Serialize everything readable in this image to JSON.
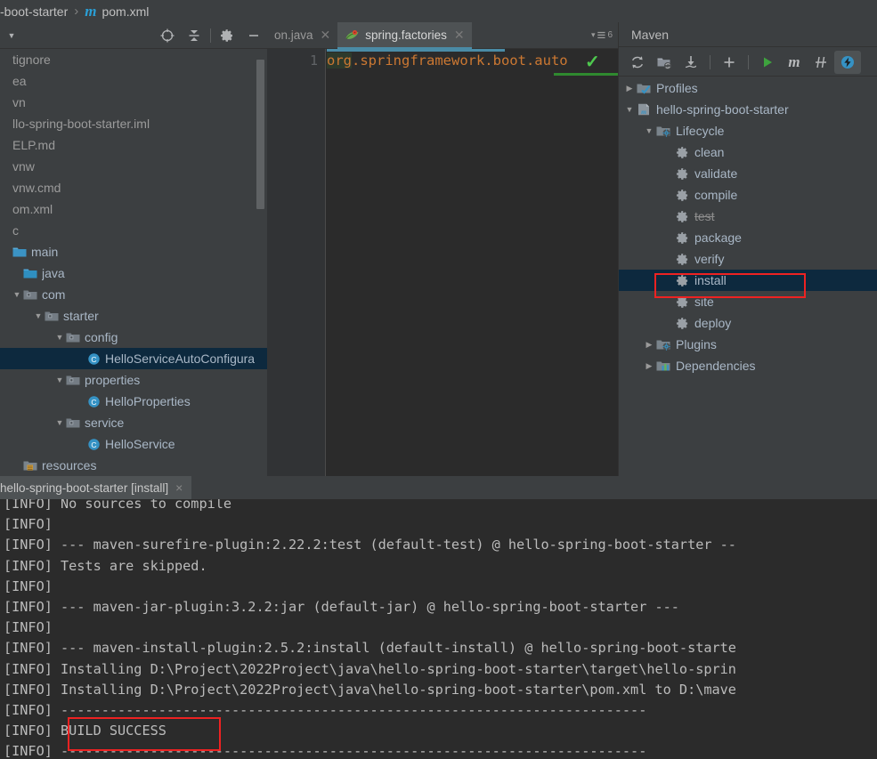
{
  "breadcrumb": {
    "project": "-boot-starter",
    "separator": "›",
    "file": "pom.xml",
    "file_icon": "maven-m-icon"
  },
  "project_panel": {
    "toolbar": [
      {
        "name": "select-opened-file-icon",
        "glyph": "▼"
      },
      {
        "name": "locate-target-icon",
        "glyph": "⊕"
      },
      {
        "name": "collapse-all-icon",
        "glyph": "⤓"
      },
      {
        "name": "settings-gear-icon",
        "glyph": "⚙"
      },
      {
        "name": "hide-panel-icon",
        "glyph": "—"
      }
    ],
    "tree": [
      {
        "label": "tignore",
        "indent": 0,
        "arrow": "",
        "icon": "none",
        "selected": false,
        "dim": true
      },
      {
        "label": "ea",
        "indent": 0,
        "arrow": "",
        "icon": "none",
        "selected": false,
        "dim": true
      },
      {
        "label": "vn",
        "indent": 0,
        "arrow": "",
        "icon": "none",
        "selected": false,
        "dim": true
      },
      {
        "label": "llo-spring-boot-starter.iml",
        "indent": 0,
        "arrow": "",
        "icon": "none",
        "selected": false,
        "dim": true
      },
      {
        "label": "ELP.md",
        "indent": 0,
        "arrow": "",
        "icon": "none",
        "selected": false,
        "dim": true
      },
      {
        "label": "vnw",
        "indent": 0,
        "arrow": "",
        "icon": "none",
        "selected": false,
        "dim": true
      },
      {
        "label": "vnw.cmd",
        "indent": 0,
        "arrow": "",
        "icon": "none",
        "selected": false,
        "dim": true
      },
      {
        "label": "om.xml",
        "indent": 0,
        "arrow": "",
        "icon": "none",
        "selected": false,
        "dim": true
      },
      {
        "label": "c",
        "indent": 0,
        "arrow": "",
        "icon": "none",
        "selected": false,
        "dim": true
      },
      {
        "label": "main",
        "indent": 0,
        "arrow": "",
        "icon": "folder",
        "selected": false,
        "dim": false
      },
      {
        "label": "java",
        "indent": 1,
        "arrow": "",
        "icon": "source-folder",
        "selected": false,
        "dim": false
      },
      {
        "label": "com",
        "indent": 1,
        "arrow": "▼",
        "icon": "package",
        "selected": false,
        "dim": false
      },
      {
        "label": "starter",
        "indent": 2,
        "arrow": "▼",
        "icon": "package",
        "selected": false,
        "dim": false
      },
      {
        "label": "config",
        "indent": 3,
        "arrow": "▼",
        "icon": "package",
        "selected": false,
        "dim": false
      },
      {
        "label": "HelloServiceAutoConfigura",
        "indent": 4,
        "arrow": "",
        "icon": "class",
        "selected": true,
        "dim": false
      },
      {
        "label": "properties",
        "indent": 3,
        "arrow": "▼",
        "icon": "package",
        "selected": false,
        "dim": false
      },
      {
        "label": "HelloProperties",
        "indent": 4,
        "arrow": "",
        "icon": "class",
        "selected": false,
        "dim": false
      },
      {
        "label": "service",
        "indent": 3,
        "arrow": "▼",
        "icon": "package",
        "selected": false,
        "dim": false
      },
      {
        "label": "HelloService",
        "indent": 4,
        "arrow": "",
        "icon": "class",
        "selected": false,
        "dim": false
      },
      {
        "label": "resources",
        "indent": 1,
        "arrow": "",
        "icon": "resource-folder",
        "selected": false,
        "dim": false
      }
    ]
  },
  "editor": {
    "tabs": [
      {
        "label": "on.java",
        "icon": "none",
        "active": false
      },
      {
        "label": "spring.factories",
        "icon": "spring-leaf-icon",
        "active": true
      }
    ],
    "tab_extra": {
      "chevron": "▾",
      "lines_icon": "≡",
      "count": "6"
    },
    "line_number": "1",
    "code": "org.springframework.boot.auto",
    "code_highlight": "org",
    "inspection_ok_glyph": "✓"
  },
  "maven": {
    "title": "Maven",
    "toolbar": [
      {
        "name": "reload-all-maven-projects-icon",
        "glyph": "↻"
      },
      {
        "name": "add-maven-project-icon",
        "glyph": "📁"
      },
      {
        "name": "download-sources-icon",
        "glyph": "⤓"
      },
      {
        "name": "separator",
        "glyph": ""
      },
      {
        "name": "add-icon",
        "glyph": "+"
      },
      {
        "name": "separator",
        "glyph": ""
      },
      {
        "name": "run-maven-build-icon",
        "glyph": "▶"
      },
      {
        "name": "execute-maven-goal-icon",
        "glyph": "m"
      },
      {
        "name": "toggle-skip-tests-icon",
        "glyph": "⫽"
      },
      {
        "name": "toggle-offline-mode-icon",
        "glyph": "⚡"
      }
    ],
    "tree": [
      {
        "label": "Profiles",
        "indent": 0,
        "arrow": "▶",
        "icon": "profiles",
        "selected": false,
        "struck": false
      },
      {
        "label": "hello-spring-boot-starter",
        "indent": 0,
        "arrow": "▼",
        "icon": "maven-project",
        "selected": false,
        "struck": false
      },
      {
        "label": "Lifecycle",
        "indent": 1,
        "arrow": "▼",
        "icon": "lifecycle",
        "selected": false,
        "struck": false
      },
      {
        "label": "clean",
        "indent": 2,
        "arrow": "",
        "icon": "goal",
        "selected": false,
        "struck": false
      },
      {
        "label": "validate",
        "indent": 2,
        "arrow": "",
        "icon": "goal",
        "selected": false,
        "struck": false
      },
      {
        "label": "compile",
        "indent": 2,
        "arrow": "",
        "icon": "goal",
        "selected": false,
        "struck": false
      },
      {
        "label": "test",
        "indent": 2,
        "arrow": "",
        "icon": "goal",
        "selected": false,
        "struck": true
      },
      {
        "label": "package",
        "indent": 2,
        "arrow": "",
        "icon": "goal",
        "selected": false,
        "struck": false
      },
      {
        "label": "verify",
        "indent": 2,
        "arrow": "",
        "icon": "goal",
        "selected": false,
        "struck": false
      },
      {
        "label": "install",
        "indent": 2,
        "arrow": "",
        "icon": "goal",
        "selected": true,
        "struck": false
      },
      {
        "label": "site",
        "indent": 2,
        "arrow": "",
        "icon": "goal",
        "selected": false,
        "struck": false
      },
      {
        "label": "deploy",
        "indent": 2,
        "arrow": "",
        "icon": "goal",
        "selected": false,
        "struck": false
      },
      {
        "label": "Plugins",
        "indent": 1,
        "arrow": "▶",
        "icon": "plugins",
        "selected": false,
        "struck": false
      },
      {
        "label": "Dependencies",
        "indent": 1,
        "arrow": "▶",
        "icon": "dependencies",
        "selected": false,
        "struck": false
      }
    ]
  },
  "console": {
    "tab_label": "hello-spring-boot-starter [install]",
    "tab_close": "×",
    "lines": [
      "[INFO] No sources to compile",
      "[INFO] ",
      "[INFO] --- maven-surefire-plugin:2.22.2:test (default-test) @ hello-spring-boot-starter --",
      "[INFO] Tests are skipped.",
      "[INFO] ",
      "[INFO] --- maven-jar-plugin:3.2.2:jar (default-jar) @ hello-spring-boot-starter ---",
      "[INFO] ",
      "[INFO] --- maven-install-plugin:2.5.2:install (default-install) @ hello-spring-boot-starte",
      "[INFO] Installing D:\\Project\\2022Project\\java\\hello-spring-boot-starter\\target\\hello-sprin",
      "[INFO] Installing D:\\Project\\2022Project\\java\\hello-spring-boot-starter\\pom.xml to D:\\mave",
      "[INFO] ------------------------------------------------------------------------",
      "[INFO] BUILD SUCCESS",
      "[INFO] ------------------------------------------------------------------------"
    ]
  },
  "annotations": {
    "install_box_color": "#ee2222",
    "build_success_box_color": "#ee2222"
  },
  "colors": {
    "panel_bg": "#3c3f41",
    "editor_bg": "#2b2b2b",
    "selection_bg": "#0d293e",
    "text": "#a9b7c6",
    "accent": "#4a8ba6",
    "code_orange": "#cc7832",
    "success_green": "#2f8a2f"
  }
}
